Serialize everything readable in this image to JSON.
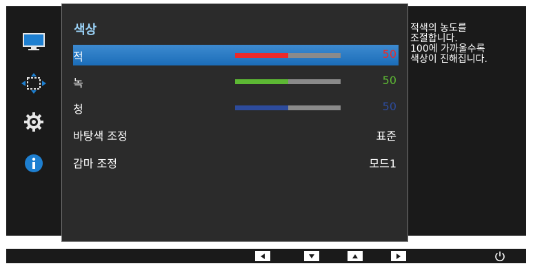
{
  "menu": {
    "title": "색상",
    "items": [
      {
        "label": "적",
        "value": "50",
        "level": 0.5,
        "fill_color": "#ea2a2a",
        "value_color": "#ea2a2a",
        "selected": true
      },
      {
        "label": "녹",
        "value": "50",
        "level": 0.5,
        "fill_color": "#5db834",
        "value_color": "#5db834",
        "selected": false
      },
      {
        "label": "청",
        "value": "50",
        "level": 0.5,
        "fill_color": "#2d4b9c",
        "value_color": "#2d4b9c",
        "selected": false
      },
      {
        "label": "바탕색 조정",
        "value": "표준"
      },
      {
        "label": "감마 조정",
        "value": "모드1"
      }
    ]
  },
  "description": {
    "lines": [
      "적색의 농도를",
      "조절합니다.",
      "100에 가까울수록",
      "색상이 진해집니다."
    ]
  },
  "sidebar": {
    "icons": [
      "monitor-icon",
      "resize-icon",
      "gear-icon",
      "info-icon"
    ]
  },
  "footer": {
    "buttons": [
      "left-arrow-icon",
      "down-arrow-icon",
      "up-arrow-icon",
      "right-arrow-icon",
      "power-icon"
    ]
  },
  "colors": {
    "accent_title": "#9ad2f7",
    "selected_row": "#1b6db8",
    "bar_track": "#8a8a8a"
  }
}
